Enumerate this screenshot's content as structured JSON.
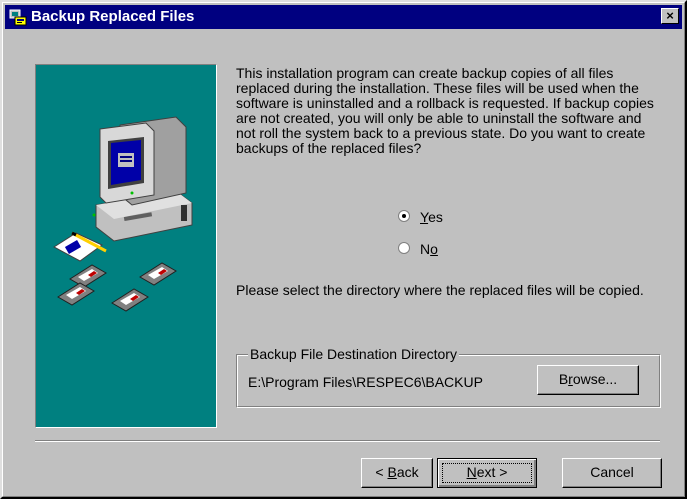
{
  "window": {
    "title": "Backup Replaced Files",
    "close_label": "×"
  },
  "description": "This installation program can create backup copies of all files replaced during the installation. These files will be used when the software is uninstalled and a rollback is requested.  If backup copies are not created, you will only be able to uninstall the software and not roll the system back to a previous state. Do you want to create backups of the replaced files?",
  "options": {
    "yes": {
      "label_pre": "",
      "label_key": "Y",
      "label_post": "es",
      "selected": true
    },
    "no": {
      "label_pre": "N",
      "label_key": "o",
      "label_post": "",
      "selected": false
    }
  },
  "select_text": "Please select the directory where the replaced  files will be copied.",
  "destination": {
    "group_label": "Backup File Destination Directory",
    "path": "E:\\Program Files\\RESPEC6\\BACKUP",
    "browse_pre": "B",
    "browse_key": "r",
    "browse_post": "owse..."
  },
  "buttons": {
    "back_pre": "< ",
    "back_key": "B",
    "back_post": "ack",
    "next_key": "N",
    "next_post": "ext >",
    "cancel": "Cancel"
  },
  "colors": {
    "title_bar": "#000080",
    "graphic_bg": "#008080",
    "face": "#c0c0c0"
  }
}
